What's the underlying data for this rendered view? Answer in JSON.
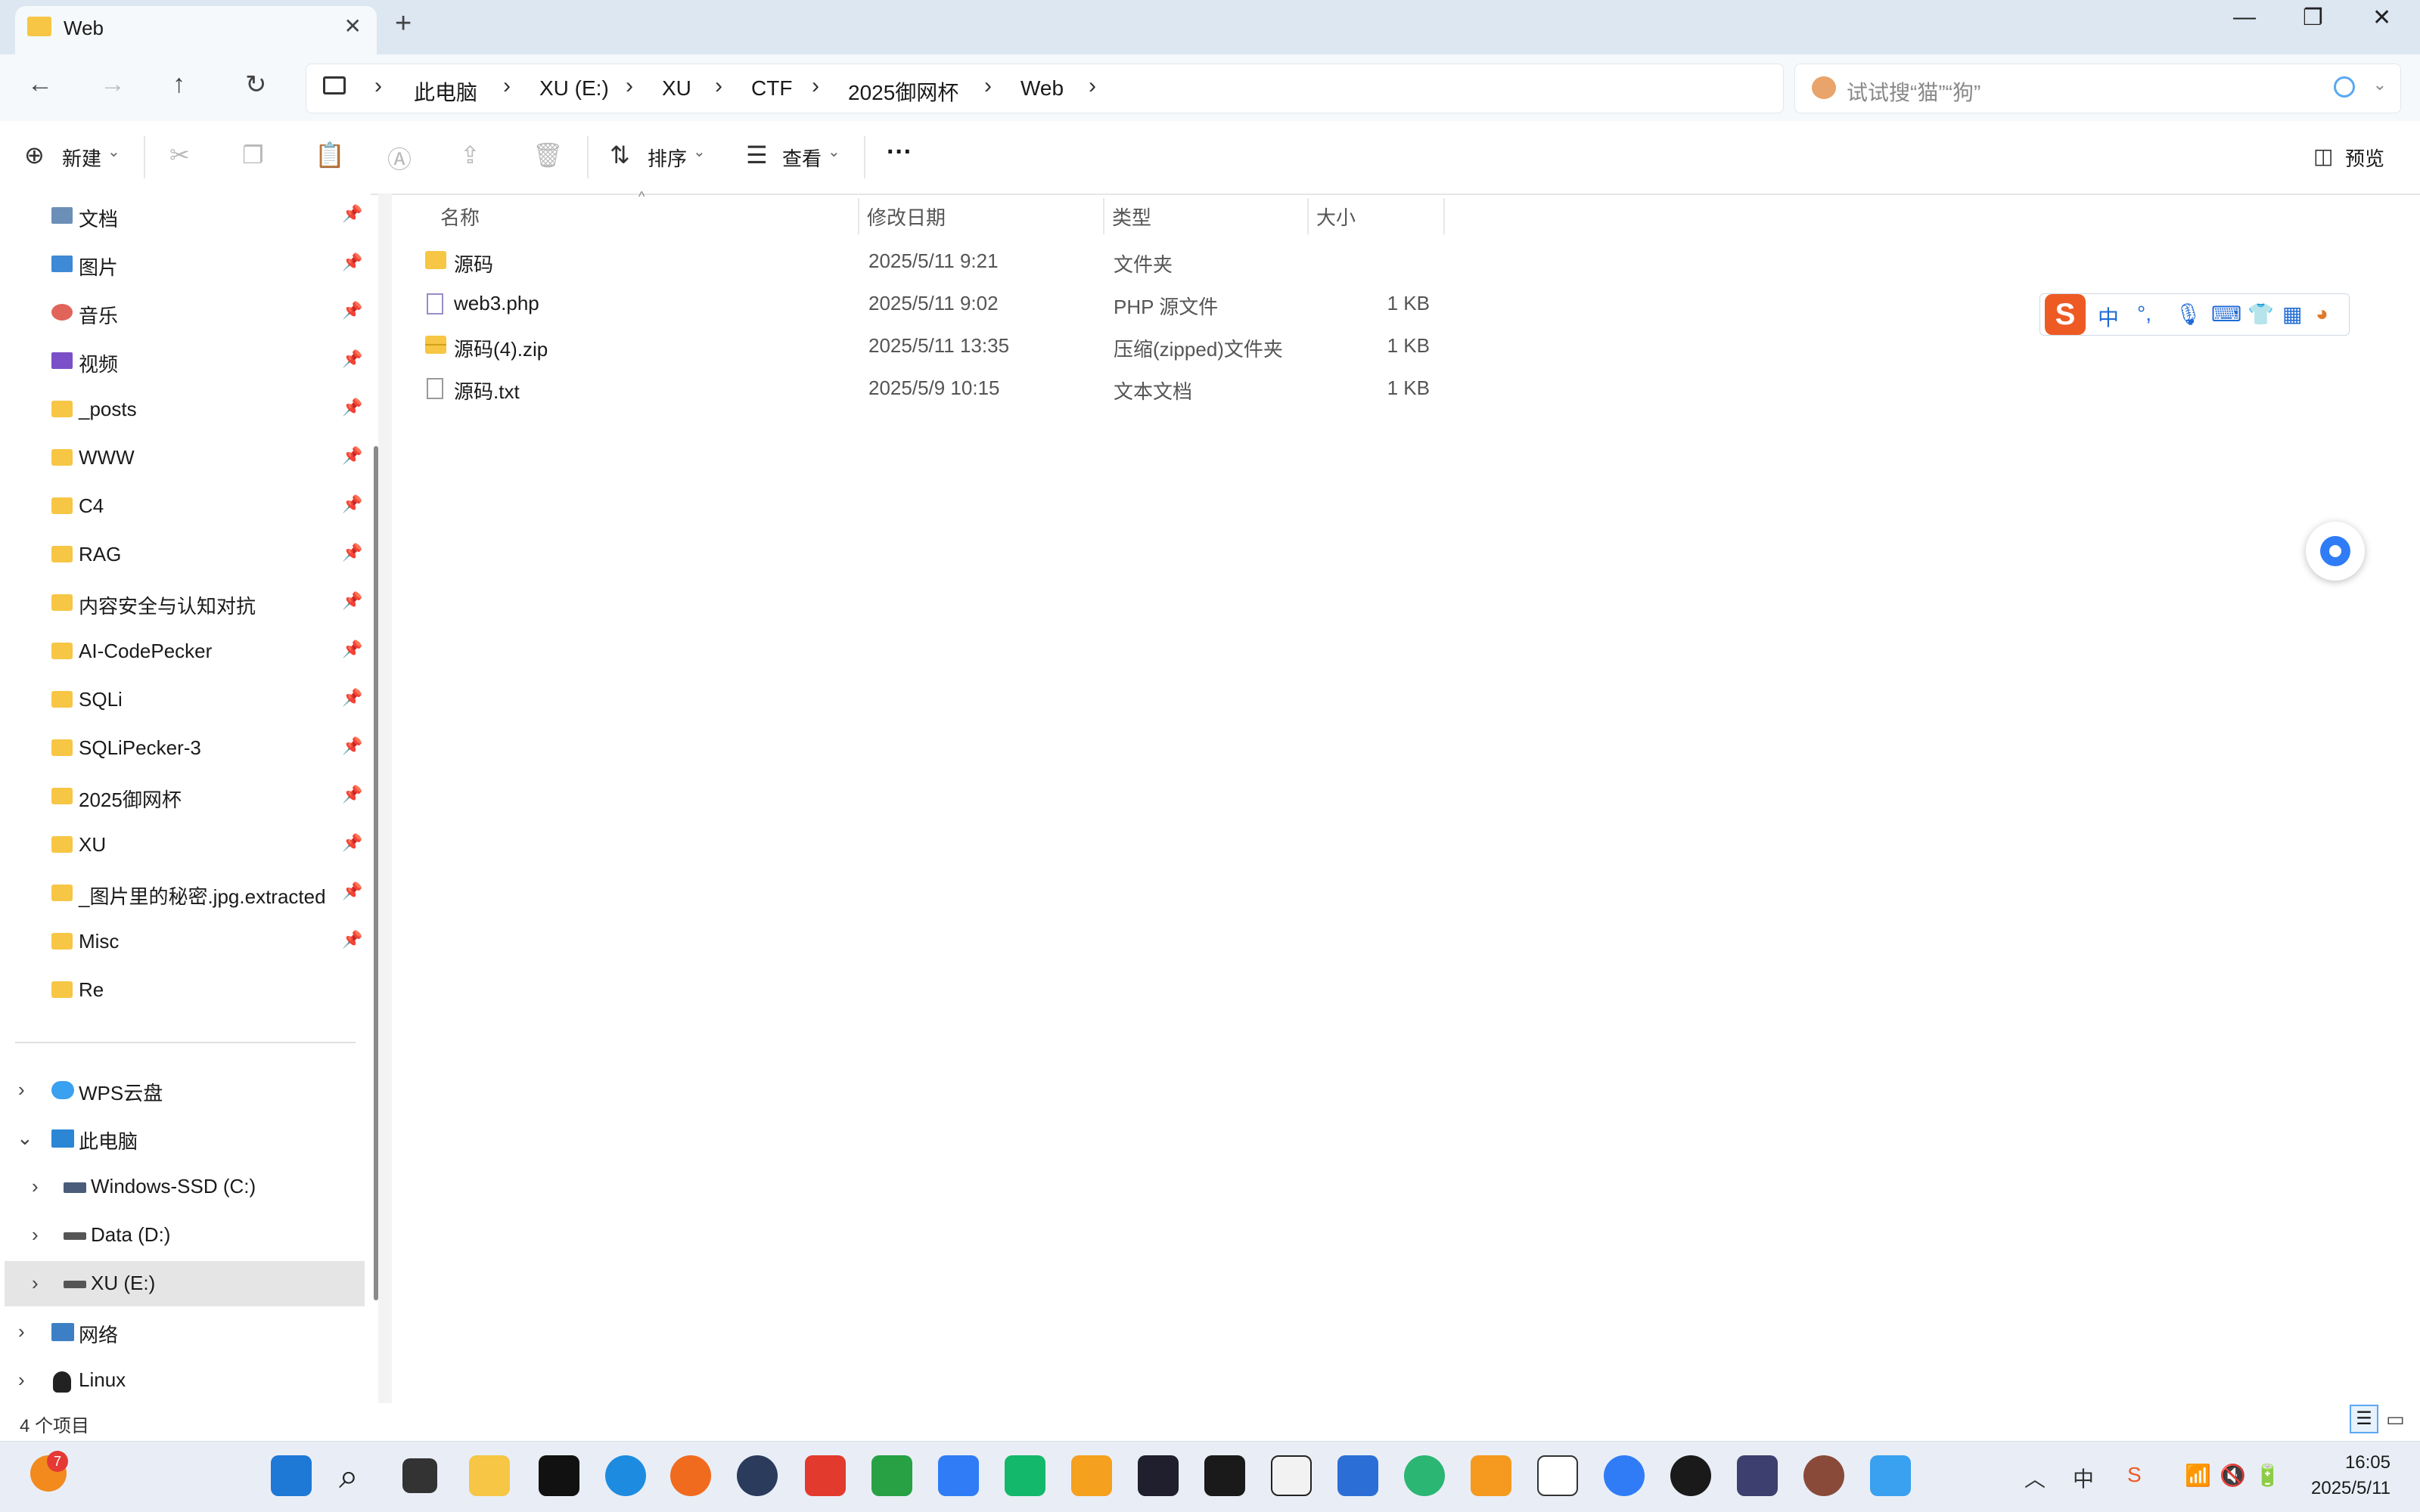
{
  "window": {
    "tab_title": "Web",
    "tab_close": "✕",
    "new_tab": "+",
    "minimize": "—",
    "restore": "❐",
    "close": "✕"
  },
  "nav": {
    "back": "←",
    "forward": "→",
    "up": "↑",
    "refresh": "↻",
    "breadcrumbs": [
      "此电脑",
      "XU (E:)",
      "XU",
      "CTF",
      "2025御网杯",
      "Web"
    ],
    "search_placeholder": "试试搜“猫”“狗”"
  },
  "toolbar": {
    "new_label": "新建",
    "sort_label": "排序",
    "view_label": "查看",
    "more_label": "···",
    "preview_label": "预览"
  },
  "sidebar": {
    "quick_access": [
      {
        "label": "文档",
        "icon": "documents-icon",
        "color": "#6c8fb8"
      },
      {
        "label": "图片",
        "icon": "pictures-icon",
        "color": "#3e8ad6"
      },
      {
        "label": "音乐",
        "icon": "music-icon",
        "color": "#e0645a"
      },
      {
        "label": "视频",
        "icon": "videos-icon",
        "color": "#7a4fc8"
      },
      {
        "label": "_posts",
        "icon": "folder-icon",
        "color": "#f6c644"
      },
      {
        "label": "WWW",
        "icon": "folder-icon",
        "color": "#f6c644"
      },
      {
        "label": "C4",
        "icon": "folder-icon",
        "color": "#f6c644"
      },
      {
        "label": "RAG",
        "icon": "folder-icon",
        "color": "#f6c644"
      },
      {
        "label": "内容安全与认知对抗",
        "icon": "folder-icon",
        "color": "#f6c644"
      },
      {
        "label": "AI-CodePecker",
        "icon": "folder-icon",
        "color": "#f6c644"
      },
      {
        "label": "SQLi",
        "icon": "folder-icon",
        "color": "#f6c644"
      },
      {
        "label": "SQLiPecker-3",
        "icon": "folder-icon",
        "color": "#f6c644"
      },
      {
        "label": "2025御网杯",
        "icon": "folder-icon",
        "color": "#f6c644"
      },
      {
        "label": "XU",
        "icon": "folder-icon",
        "color": "#f6c644"
      },
      {
        "label": "_图片里的秘密.jpg.extracted",
        "icon": "folder-icon",
        "color": "#f6c644"
      },
      {
        "label": "Misc",
        "icon": "folder-icon",
        "color": "#f6c644"
      },
      {
        "label": "Re",
        "icon": "folder-icon",
        "color": "#f6c644"
      }
    ],
    "tree": [
      {
        "label": "WPS云盘",
        "arrow": "›",
        "icon": "cloud-icon"
      },
      {
        "label": "此电脑",
        "arrow": "⌄",
        "icon": "computer-icon"
      },
      {
        "label": "Windows-SSD (C:)",
        "arrow": "›",
        "icon": "drive-icon"
      },
      {
        "label": "Data (D:)",
        "arrow": "›",
        "icon": "drive-icon"
      },
      {
        "label": "XU (E:)",
        "arrow": "›",
        "icon": "drive-icon"
      },
      {
        "label": "网络",
        "arrow": "›",
        "icon": "network-icon"
      },
      {
        "label": "Linux",
        "arrow": "›",
        "icon": "linux-icon"
      }
    ]
  },
  "columns": {
    "name": "名称",
    "date": "修改日期",
    "type": "类型",
    "size": "大小"
  },
  "files": [
    {
      "name": "源码",
      "date": "2025/5/11 9:21",
      "type": "文件夹",
      "size": "",
      "icon": "folder-icon"
    },
    {
      "name": "web3.php",
      "date": "2025/5/11 9:02",
      "type": "PHP 源文件",
      "size": "1 KB",
      "icon": "php-file-icon"
    },
    {
      "name": "源码(4).zip",
      "date": "2025/5/11 13:35",
      "type": "压缩(zipped)文件夹",
      "size": "1 KB",
      "icon": "zip-folder-icon"
    },
    {
      "name": "源码.txt",
      "date": "2025/5/9 10:15",
      "type": "文本文档",
      "size": "1 KB",
      "icon": "text-file-icon"
    }
  ],
  "ime": {
    "logo": "S",
    "mode": "中",
    "punct": "°,"
  },
  "status": {
    "item_count": "4 个项目"
  },
  "taskbar": {
    "badge": "7",
    "time": "16:05",
    "date": "2025/5/11"
  }
}
